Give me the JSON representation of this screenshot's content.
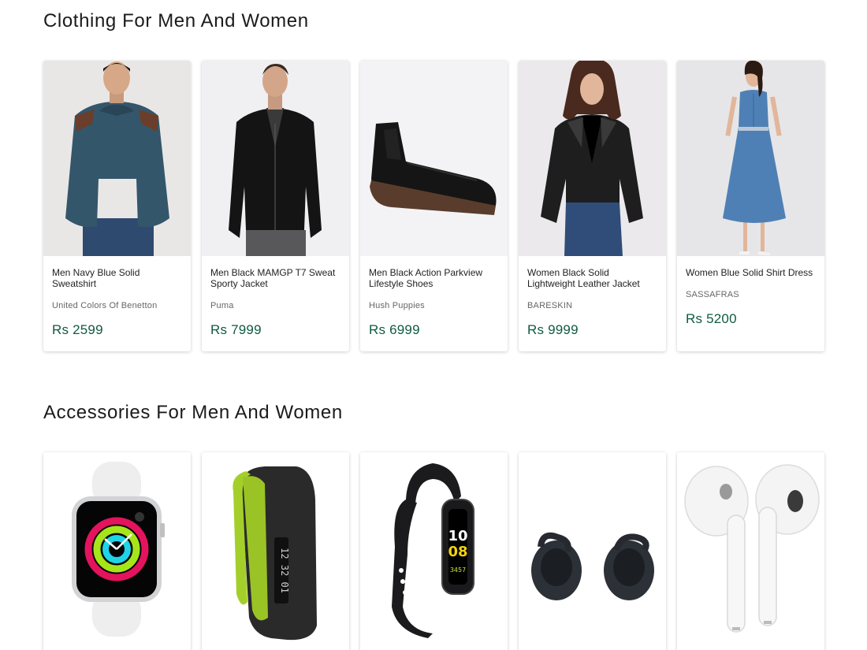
{
  "sections": [
    {
      "title": "Clothing For Men And Women",
      "products": [
        {
          "name": "Men Navy Blue Solid Sweatshirt",
          "brand": "United Colors Of Benetton",
          "price": "Rs 2599",
          "icon": "sweatshirt-image"
        },
        {
          "name": "Men Black MAMGP T7 Sweat Sporty Jacket",
          "brand": "Puma",
          "price": "Rs 7999",
          "icon": "jacket-image"
        },
        {
          "name": "Men Black Action Parkview Lifestyle Shoes",
          "brand": "Hush Puppies",
          "price": "Rs 6999",
          "icon": "shoe-image"
        },
        {
          "name": "Women Black Solid Lightweight Leather Jacket",
          "brand": "BARESKIN",
          "price": "Rs 9999",
          "icon": "leather-jacket-image"
        },
        {
          "name": "Women Blue Solid Shirt Dress",
          "brand": "SASSAFRAS",
          "price": "Rs 5200",
          "icon": "dress-image"
        }
      ]
    },
    {
      "title": "Accessories For Men And Women",
      "products": [
        {
          "icon": "smartwatch-image"
        },
        {
          "icon": "fitness-band-image"
        },
        {
          "icon": "fitness-tracker-image",
          "display_time_h": "10",
          "display_time_m": "08",
          "display_steps": "3457"
        },
        {
          "icon": "earbuds-image"
        },
        {
          "icon": "airpods-image"
        }
      ]
    }
  ],
  "band_display": "12 32 01",
  "colors": {
    "price": "#0f5a43",
    "title": "#1b1b1b"
  }
}
